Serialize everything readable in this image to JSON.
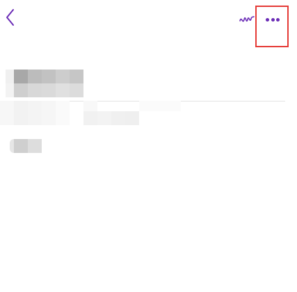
{
  "colors": {
    "accent": "#6a2bb6",
    "highlight_border": "#e53935",
    "divider": "#e4e4e4"
  },
  "header": {
    "back_icon": "chevron-left-icon",
    "handwriting_icon": "scribble-pen-icon",
    "more_icon": "more-horizontal-icon"
  },
  "content": {
    "title_text": "",
    "subtitle_text": "",
    "tag_text": ""
  }
}
